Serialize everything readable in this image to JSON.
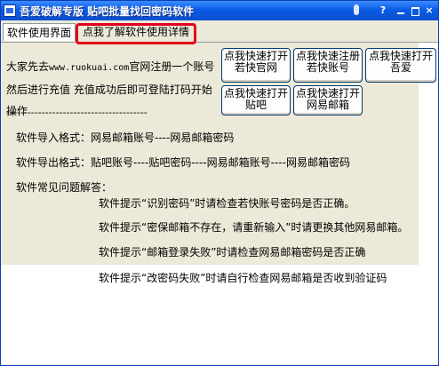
{
  "window": {
    "title": "吾爱破解专版 贴吧批量找回密码软件"
  },
  "titlebar": {
    "help_glyph": "?",
    "close_glyph": "×"
  },
  "tabs": [
    {
      "label": "软件使用界面"
    },
    {
      "label": "点我了解软件使用详情"
    }
  ],
  "intro": {
    "before_site": "大家先去",
    "site": "www.ruokuai.com",
    "after_site": "官网注册一个账号然后进行充值 充值成功后即可登陆打码开始操作",
    "separator": "----------------------------------------"
  },
  "buttons": [
    {
      "line1": "点我快速打开",
      "line2": "若快官网"
    },
    {
      "line1": "点我快速注册",
      "line2": "若快账号"
    },
    {
      "line1": "点我快速打开",
      "line2": "吾爱"
    },
    {
      "line1": "点我快速打开",
      "line2": "贴吧"
    },
    {
      "line1": "点我快速打开",
      "line2": "网易邮箱"
    }
  ],
  "info": {
    "import_format": "软件导入格式：网易邮箱账号----网易邮箱密码",
    "export_format": "软件导出格式：贴吧账号----贴吧密码----网易邮箱账号----网易邮箱密码",
    "faq_title": "软件常见问题解答：",
    "faq": [
      "软件提示“识别密码”时请检查若快账号密码是否正确。",
      "软件提示“密保邮箱不存在，请重新输入”时请更换其他网易邮箱。",
      "软件提示“邮箱登录失败”时请检查网易邮箱密码是否正确",
      "软件提示“改密码失败”时请自行检查网易邮箱是否收到验证码"
    ]
  }
}
